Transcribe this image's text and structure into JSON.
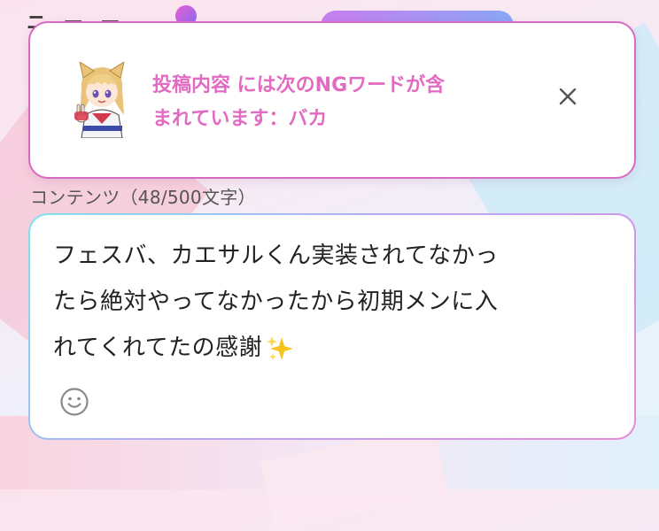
{
  "toast": {
    "message_line1": "投稿内容 には次のNGワードが含",
    "message_line2": "まれています：バカ",
    "accent_color": "#e26bc2",
    "close_icon": "close-icon",
    "avatar_icon": "character-avatar"
  },
  "editor": {
    "counter_label": "コンテンツ（48/500文字）",
    "content_line1": "フェスバ、カエサルくん実装されてなかっ",
    "content_line2": "たら絶対やってなかったから初期メンに入",
    "content_line3": "れてくれてたの感謝",
    "emoji_icon": "smiley-icon",
    "sparkles_icon": "sparkles-icon"
  }
}
